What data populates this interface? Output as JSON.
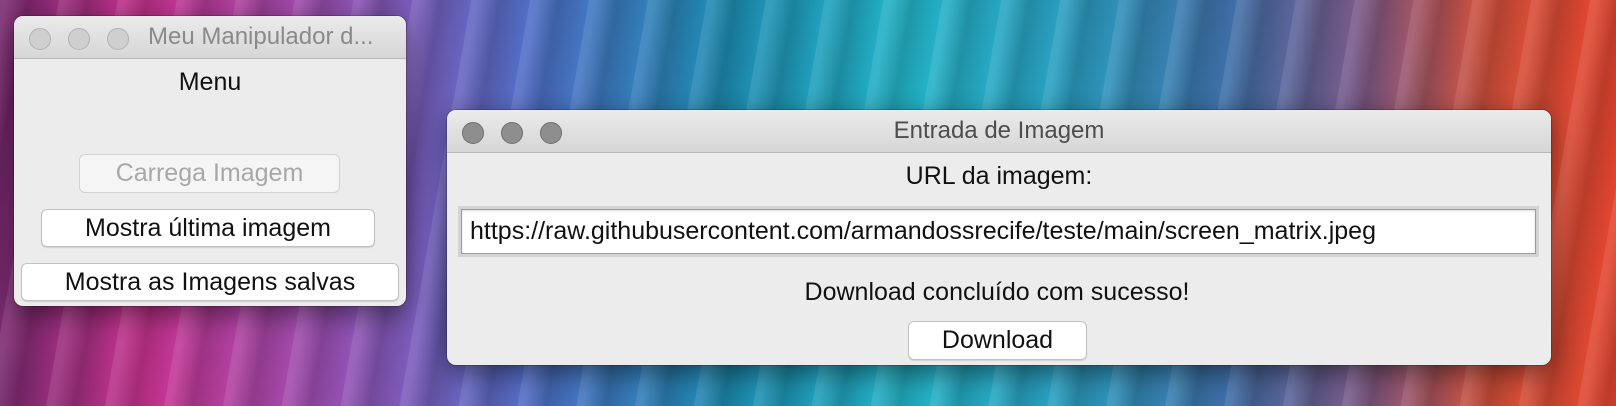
{
  "menu_window": {
    "title": "Meu Manipulador d...",
    "heading": "Menu",
    "buttons": {
      "load_image": "Carrega Imagem",
      "show_last_image": "Mostra última imagem",
      "show_saved_images": "Mostra as Imagens salvas"
    },
    "load_image_disabled": true
  },
  "image_input_window": {
    "title": "Entrada de Imagem",
    "url_label": "URL da imagem:",
    "url_value": "https://raw.githubusercontent.com/armandossrecife/teste/main/screen_matrix.jpeg",
    "status_message": "Download concluído com sucesso!",
    "download_button": "Download"
  },
  "colors": {
    "window_background": "#ececec",
    "desktop_accent_blue": "#23b4c8",
    "desktop_accent_pink": "#c8338f",
    "desktop_accent_orange": "#e2452f"
  }
}
